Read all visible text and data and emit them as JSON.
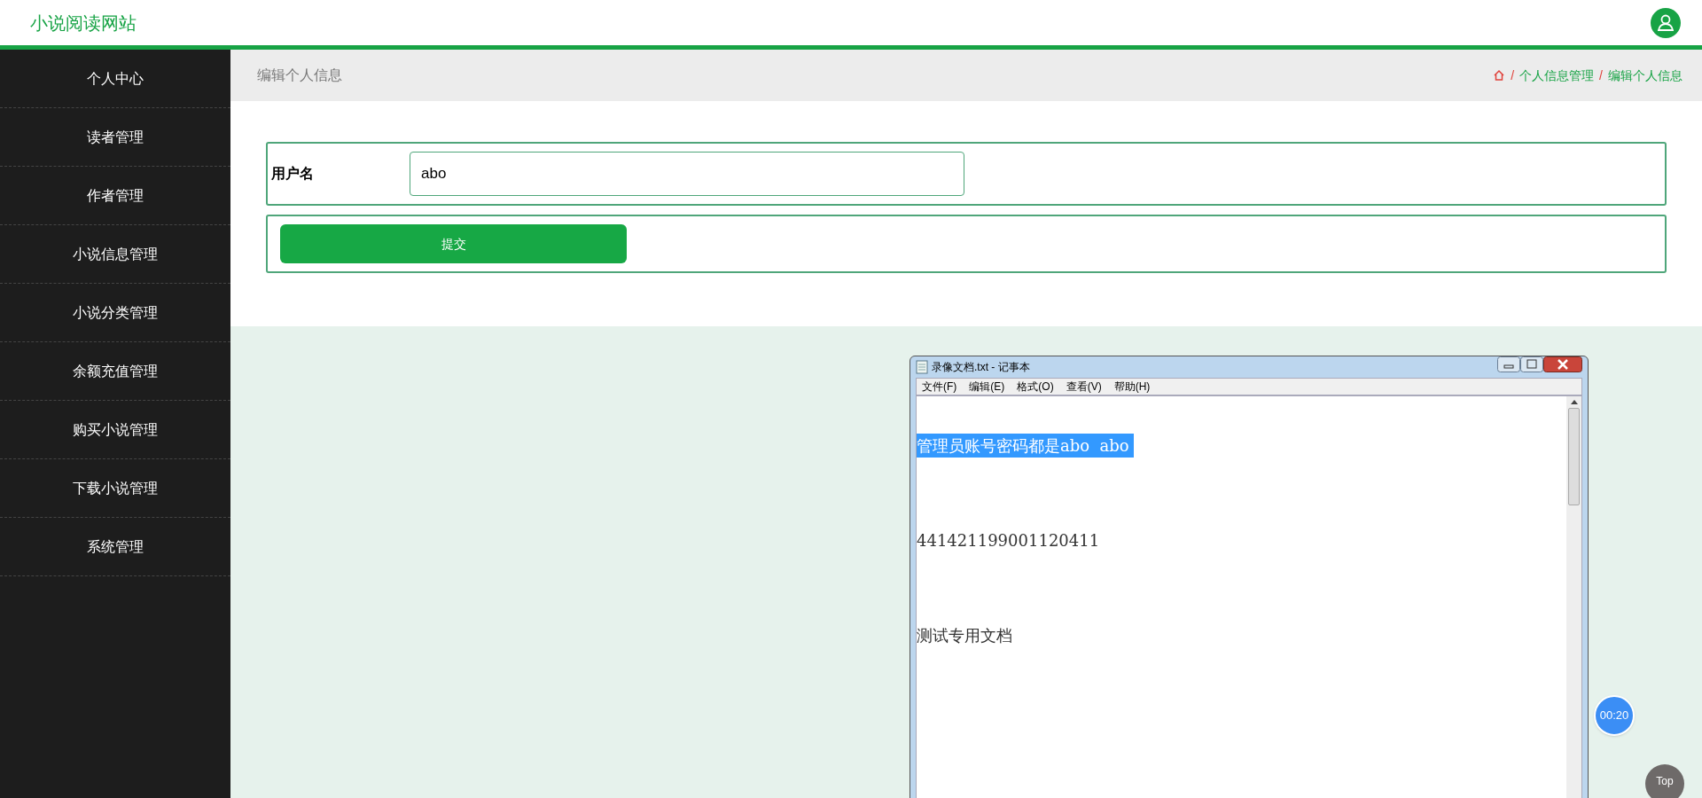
{
  "header": {
    "site_title": "小说阅读网站"
  },
  "sidebar": {
    "items": [
      {
        "label": "个人中心"
      },
      {
        "label": "读者管理"
      },
      {
        "label": "作者管理"
      },
      {
        "label": "小说信息管理"
      },
      {
        "label": "小说分类管理"
      },
      {
        "label": "余额充值管理"
      },
      {
        "label": "购买小说管理"
      },
      {
        "label": "下载小说管理"
      },
      {
        "label": "系统管理"
      }
    ]
  },
  "page_title": "编辑个人信息",
  "breadcrumb": [
    {
      "separator": "/",
      "label": "个人信息管理"
    },
    {
      "separator": "/",
      "label": "编辑个人信息"
    }
  ],
  "form": {
    "field_label": "用户名",
    "field_value": "abo",
    "submit": "提交"
  },
  "notepad": {
    "title": "录像文档.txt - 记事本",
    "menu": [
      "文件(F)",
      "编辑(E)",
      "格式(O)",
      "查看(V)",
      "帮助(H)"
    ],
    "lines": [
      {
        "text": "管理员账号密码都是abo  abo ",
        "selected": true
      },
      {
        "text": "441421199001120411",
        "selected": false
      },
      {
        "text": "测试专用文档",
        "selected": false
      }
    ]
  },
  "timer": "00:20",
  "top_button": "Top"
}
